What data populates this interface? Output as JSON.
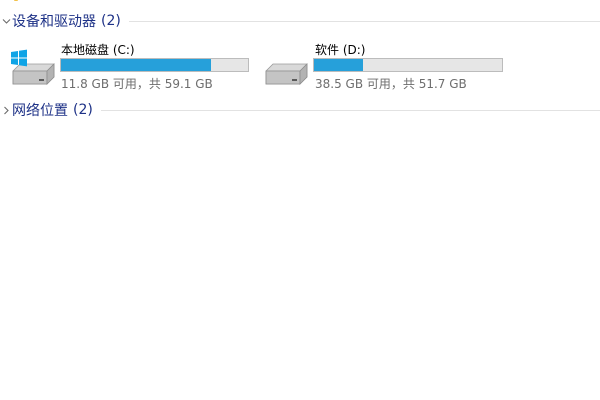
{
  "groups": {
    "devices": {
      "title": "设备和驱动器",
      "count": "(2)",
      "expanded": true
    },
    "network": {
      "title": "网络位置",
      "count": "(2)",
      "expanded": false
    }
  },
  "drives": [
    {
      "name": "本地磁盘 (C:)",
      "info": "11.8 GB 可用，共 59.1 GB",
      "used_fraction": 0.8,
      "icon": "windows-system-drive-icon"
    },
    {
      "name": "软件 (D:)",
      "info": "38.5 GB 可用，共 51.7 GB",
      "used_fraction": 0.26,
      "icon": "hard-drive-icon"
    }
  ],
  "colors": {
    "group_title": "#1e3287",
    "bar_fill": "#26a0da",
    "bar_track": "#e6e6e6",
    "info_text": "#6d6d6d"
  }
}
